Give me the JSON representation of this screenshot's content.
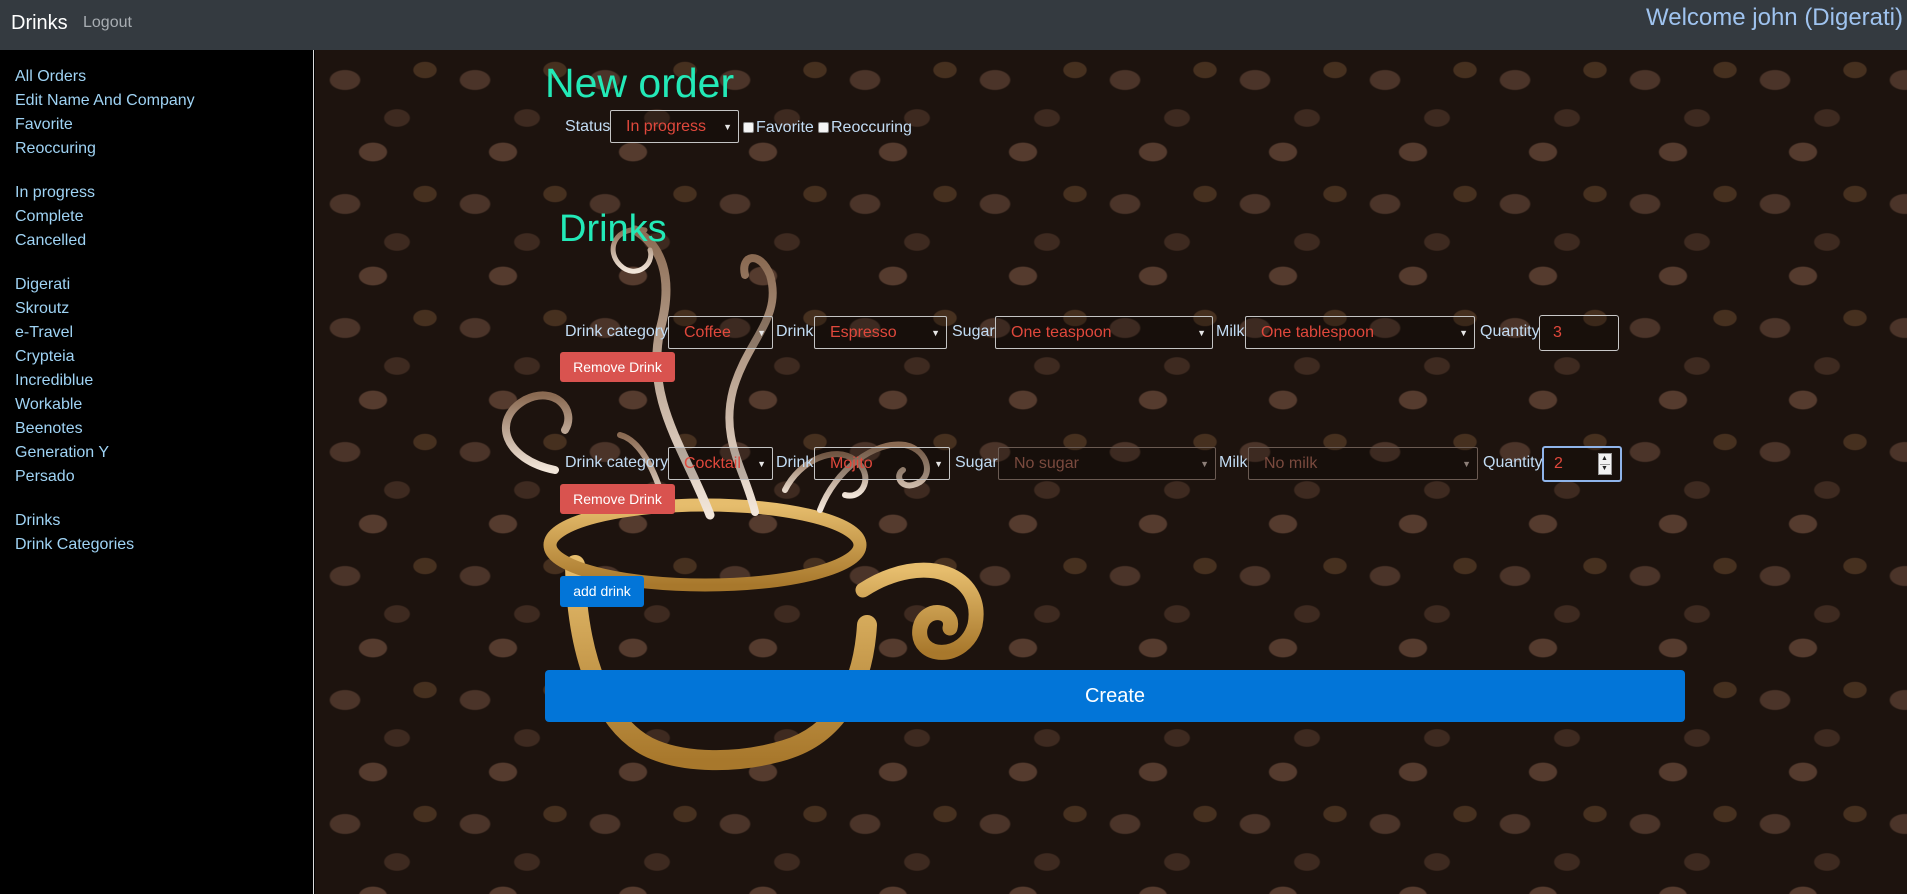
{
  "navbar": {
    "brand": "Drinks",
    "logout": "Logout",
    "welcome": "Welcome john (Digerati)"
  },
  "sidebar": {
    "groups": [
      [
        "All Orders",
        "Edit Name And Company",
        "Favorite",
        "Reoccuring"
      ],
      [
        "In progress",
        "Complete",
        "Cancelled"
      ],
      [
        "Digerati",
        "Skroutz",
        "e-Travel",
        "Crypteia",
        "Incrediblue",
        "Workable",
        "Beenotes",
        "Generation Y",
        "Persado"
      ],
      [
        "Drinks",
        "Drink Categories"
      ]
    ]
  },
  "order": {
    "title": "New order",
    "status_label": "Status",
    "status_value": "In progress",
    "favorite_label": "Favorite",
    "reoccuring_label": "Reoccuring",
    "favorite_checked": false,
    "reoccuring_checked": false
  },
  "drinks_section": {
    "title": "Drinks",
    "labels": {
      "category": "Drink category",
      "drink": "Drink",
      "sugar": "Sugar",
      "milk": "Milk",
      "quantity": "Quantity"
    },
    "remove_label": "Remove Drink",
    "rows": [
      {
        "category": "Coffee",
        "drink": "Espresso",
        "sugar": "One teaspoon",
        "milk": "One tablespoon",
        "quantity": "3"
      },
      {
        "category": "Cocktail",
        "drink": "Mojito",
        "sugar": "No sugar",
        "milk": "No milk",
        "quantity": "2"
      }
    ],
    "add_label": "add drink"
  },
  "create_label": "Create",
  "colors": {
    "heading": "#23e9b7",
    "primary": "#0275d8",
    "danger": "#d9534f",
    "select_text": "#e0483c",
    "link": "#9fd3f4",
    "navbar": "#343a40"
  }
}
